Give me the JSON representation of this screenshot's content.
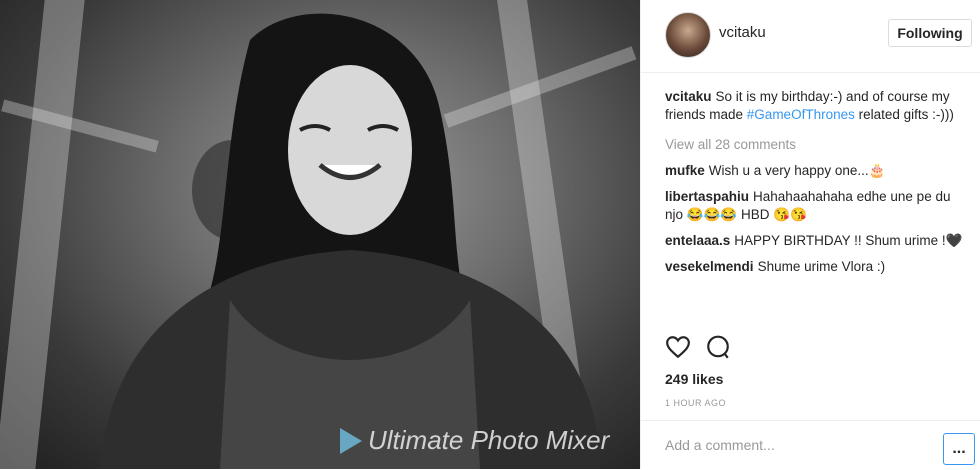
{
  "post": {
    "username": "vcitaku",
    "follow_label": "Following",
    "caption": {
      "user": "vcitaku",
      "text_before": "So it is my birthday:-) and of course my friends made ",
      "hashtag": "#GameOfThrones",
      "text_after": " related gifts :-)))"
    },
    "view_all": "View all 28 comments",
    "comments": [
      {
        "user": "mufke",
        "text": "Wish u a very happy one...🎂"
      },
      {
        "user": "libertaspahiu",
        "text": "Hahahaahahaha edhe une pe du njo 😂😂😂 HBD 😘😘"
      },
      {
        "user": "entelaaa.s",
        "text": "HAPPY BIRTHDAY !! Shum urime !🖤"
      },
      {
        "user": "vesekelmendi",
        "text": "Shume urime Vlora :)"
      }
    ],
    "likes": "249 likes",
    "time": "1 HOUR AGO",
    "add_comment_placeholder": "Add a comment...",
    "more_label": "..."
  },
  "photo": {
    "watermark": "Ultimate Photo Mixer"
  }
}
